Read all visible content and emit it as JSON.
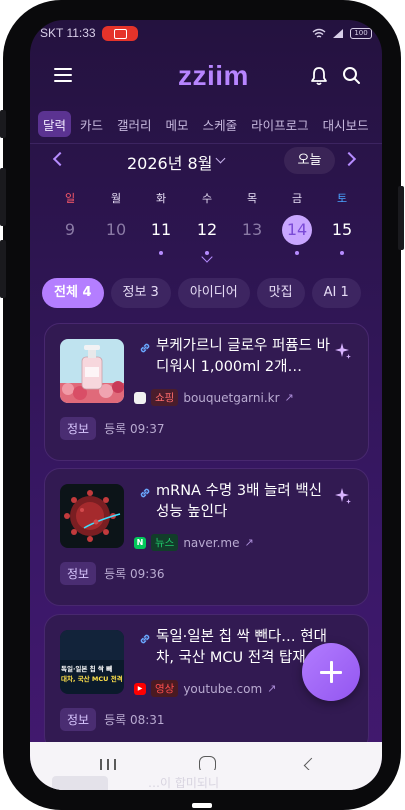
{
  "status_bar": {
    "carrier_time": "SKT 11:33",
    "battery": "100"
  },
  "app": {
    "logo": "zziim"
  },
  "tabs": [
    "달력",
    "카드",
    "갤러리",
    "메모",
    "스케줄",
    "라이프로그",
    "대시보드"
  ],
  "calendar": {
    "month_label": "2026년 8월",
    "today_label": "오늘",
    "days": [
      {
        "name": "일",
        "num": "9",
        "name_color": "#ff5a6a"
      },
      {
        "name": "월",
        "num": "10",
        "name_color": "#e7def5"
      },
      {
        "name": "화",
        "num": "11",
        "name_color": "#e7def5"
      },
      {
        "name": "수",
        "num": "12",
        "name_color": "#e7def5"
      },
      {
        "name": "목",
        "num": "13",
        "name_color": "#e7def5"
      },
      {
        "name": "금",
        "num": "14",
        "name_color": "#e7def5"
      },
      {
        "name": "토",
        "num": "15",
        "name_color": "#4aa3ff"
      }
    ]
  },
  "filters": [
    "전체 4",
    "정보 3",
    "아이디어",
    "맛집",
    "AI 1"
  ],
  "cards": [
    {
      "title": "부케가르니 글로우 퍼퓸드 바디워시 1,000ml 2개…",
      "badge": "쇼핑",
      "badge_color": "#ff6b6b",
      "source": "bouquetgarni.kr",
      "tag": "정보",
      "registered": "등록 09:37"
    },
    {
      "title": "mRNA 수명 3배 늘려 백신 성능 높인다",
      "badge": "뉴스",
      "badge_color": "#1fc76a",
      "source": "naver.me",
      "tag": "정보",
      "registered": "등록 09:36"
    },
    {
      "title": "독일·일본 칩 싹 뺀다… 현대차, 국산 MCU 전격 탑재",
      "badge": "영상",
      "badge_color": "#ff4d4d",
      "source": "youtube.com",
      "tag": "정보",
      "registered": "등록 08:31"
    }
  ],
  "thumb3": {
    "line1": "독일·일본 칩 싹 빼",
    "line2": "대차, 국산 MCU 전격 탑"
  },
  "peek_text": "…이 합미되니"
}
